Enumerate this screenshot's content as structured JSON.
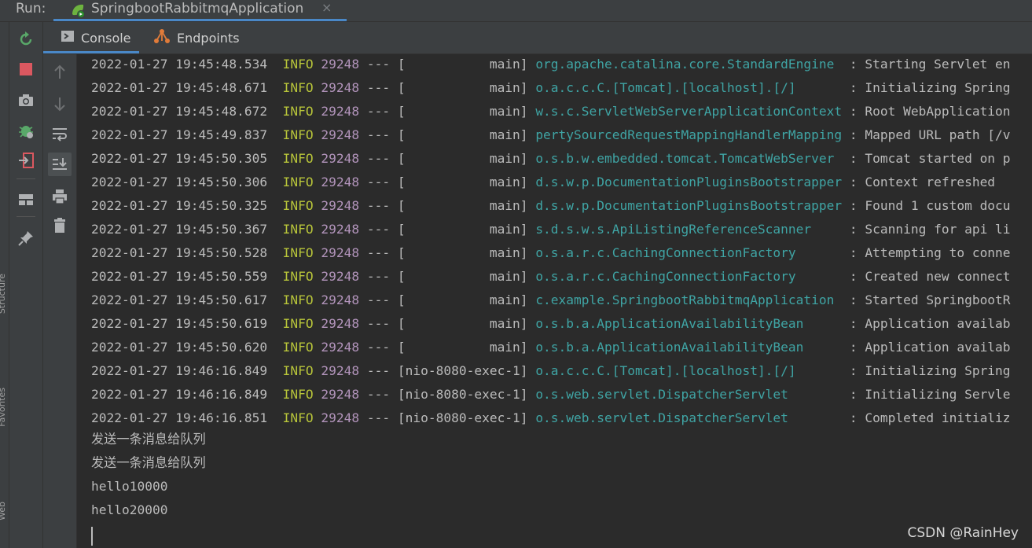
{
  "run_bar": {
    "label": "Run:",
    "tab_title": "SpringbootRabbitmqApplication",
    "tab_icon": "spring-boot-icon",
    "close_glyph": "×"
  },
  "side_labels": [
    "Structure",
    "Favorites",
    "Web"
  ],
  "toolbar_left": [
    "rerun-icon",
    "stop-icon",
    "camera-icon",
    "debug-bug-icon",
    "exit-icon",
    "layout-icon",
    "pin-icon"
  ],
  "toolbar_console": [
    "up-arrow-icon",
    "down-arrow-icon",
    "soft-wrap-icon",
    "scroll-to-end-icon",
    "print-icon",
    "trash-icon"
  ],
  "tabs": [
    {
      "label": "Console",
      "icon": "console-icon"
    },
    {
      "label": "Endpoints",
      "icon": "endpoints-icon"
    }
  ],
  "log": [
    {
      "ts": "2022-01-27 19:45:48.534",
      "level": "INFO",
      "pid": "29248",
      "sep": "---",
      "thread": "[           main]",
      "logger": "org.apache.catalina.core.StandardEngine ",
      "msg": " : Starting Servlet en"
    },
    {
      "ts": "2022-01-27 19:45:48.671",
      "level": "INFO",
      "pid": "29248",
      "sep": "---",
      "thread": "[           main]",
      "logger": "o.a.c.c.C.[Tomcat].[localhost].[/]      ",
      "msg": " : Initializing Spring"
    },
    {
      "ts": "2022-01-27 19:45:48.672",
      "level": "INFO",
      "pid": "29248",
      "sep": "---",
      "thread": "[           main]",
      "logger": "w.s.c.ServletWebServerApplicationContext",
      "msg": " : Root WebApplication"
    },
    {
      "ts": "2022-01-27 19:45:49.837",
      "level": "INFO",
      "pid": "29248",
      "sep": "---",
      "thread": "[           main]",
      "logger": "pertySourcedRequestMappingHandlerMapping",
      "msg": " : Mapped URL path [/v"
    },
    {
      "ts": "2022-01-27 19:45:50.305",
      "level": "INFO",
      "pid": "29248",
      "sep": "---",
      "thread": "[           main]",
      "logger": "o.s.b.w.embedded.tomcat.TomcatWebServer ",
      "msg": " : Tomcat started on p"
    },
    {
      "ts": "2022-01-27 19:45:50.306",
      "level": "INFO",
      "pid": "29248",
      "sep": "---",
      "thread": "[           main]",
      "logger": "d.s.w.p.DocumentationPluginsBootstrapper",
      "msg": " : Context refreshed"
    },
    {
      "ts": "2022-01-27 19:45:50.325",
      "level": "INFO",
      "pid": "29248",
      "sep": "---",
      "thread": "[           main]",
      "logger": "d.s.w.p.DocumentationPluginsBootstrapper",
      "msg": " : Found 1 custom docu"
    },
    {
      "ts": "2022-01-27 19:45:50.367",
      "level": "INFO",
      "pid": "29248",
      "sep": "---",
      "thread": "[           main]",
      "logger": "s.d.s.w.s.ApiListingReferenceScanner    ",
      "msg": " : Scanning for api li"
    },
    {
      "ts": "2022-01-27 19:45:50.528",
      "level": "INFO",
      "pid": "29248",
      "sep": "---",
      "thread": "[           main]",
      "logger": "o.s.a.r.c.CachingConnectionFactory      ",
      "msg": " : Attempting to conne"
    },
    {
      "ts": "2022-01-27 19:45:50.559",
      "level": "INFO",
      "pid": "29248",
      "sep": "---",
      "thread": "[           main]",
      "logger": "o.s.a.r.c.CachingConnectionFactory      ",
      "msg": " : Created new connect"
    },
    {
      "ts": "2022-01-27 19:45:50.617",
      "level": "INFO",
      "pid": "29248",
      "sep": "---",
      "thread": "[           main]",
      "logger": "c.example.SpringbootRabbitmqApplication ",
      "msg": " : Started SpringbootR"
    },
    {
      "ts": "2022-01-27 19:45:50.619",
      "level": "INFO",
      "pid": "29248",
      "sep": "---",
      "thread": "[           main]",
      "logger": "o.s.b.a.ApplicationAvailabilityBean     ",
      "msg": " : Application availab"
    },
    {
      "ts": "2022-01-27 19:45:50.620",
      "level": "INFO",
      "pid": "29248",
      "sep": "---",
      "thread": "[           main]",
      "logger": "o.s.b.a.ApplicationAvailabilityBean     ",
      "msg": " : Application availab"
    },
    {
      "ts": "2022-01-27 19:46:16.849",
      "level": "INFO",
      "pid": "29248",
      "sep": "---",
      "thread": "[nio-8080-exec-1]",
      "logger": "o.a.c.c.C.[Tomcat].[localhost].[/]      ",
      "msg": " : Initializing Spring"
    },
    {
      "ts": "2022-01-27 19:46:16.849",
      "level": "INFO",
      "pid": "29248",
      "sep": "---",
      "thread": "[nio-8080-exec-1]",
      "logger": "o.s.web.servlet.DispatcherServlet       ",
      "msg": " : Initializing Servle"
    },
    {
      "ts": "2022-01-27 19:46:16.851",
      "level": "INFO",
      "pid": "29248",
      "sep": "---",
      "thread": "[nio-8080-exec-1]",
      "logger": "o.s.web.servlet.DispatcherServlet       ",
      "msg": " : Completed initializ"
    }
  ],
  "output": [
    "发送一条消息给队列",
    "发送一条消息给队列",
    "hello10000",
    "hello20000"
  ],
  "watermark": "CSDN @RainHey",
  "colors": {
    "info": "#b8c53a",
    "pid": "#b294bb",
    "logger": "#3fa4a4",
    "accent": "#4a88c7"
  }
}
